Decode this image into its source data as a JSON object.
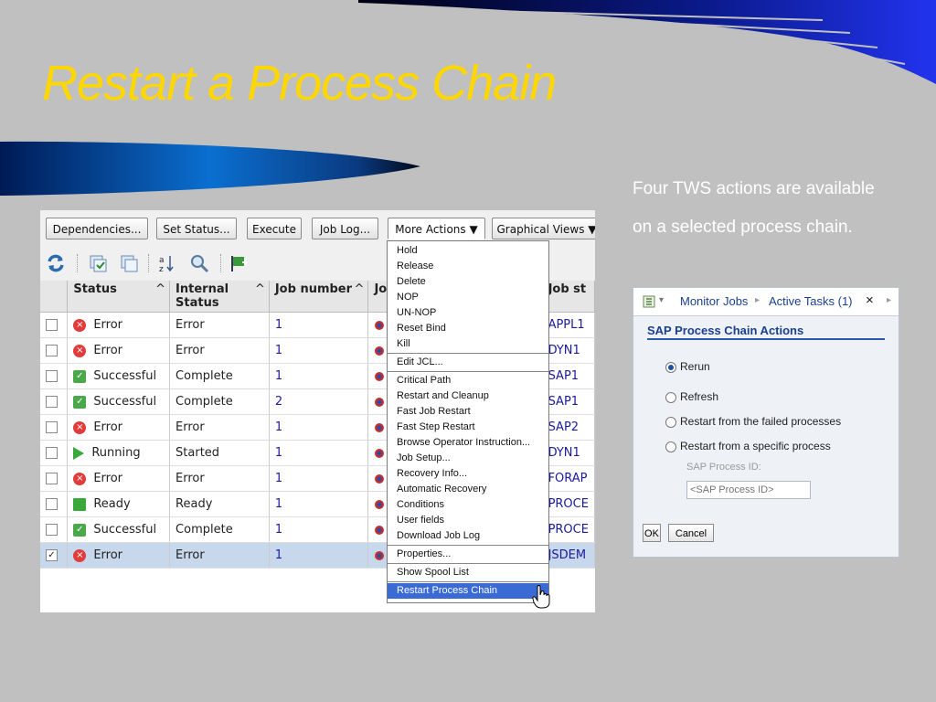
{
  "slide": {
    "title": "Restart a Process Chain",
    "description_line1": "Four TWS actions are available",
    "description_line2": "on a selected process chain."
  },
  "toolbar": {
    "dependencies": "Dependencies...",
    "set_status": "Set Status...",
    "execute": "Execute",
    "job_log": "Job Log...",
    "more_actions": "More Actions ▼",
    "graphical_views": "Graphical Views ▼"
  },
  "table": {
    "headers": {
      "status": "Status",
      "internal_status": "Internal Status",
      "job_number": "Job number",
      "job_name_prefix": "Jo",
      "job_stream": "Job st"
    },
    "rows": [
      {
        "status": "Error",
        "internal": "Error",
        "number": "1",
        "stream": "APPL1",
        "selected": false,
        "kind": "err"
      },
      {
        "status": "Error",
        "internal": "Error",
        "number": "1",
        "stream": "DYN1",
        "selected": false,
        "kind": "err"
      },
      {
        "status": "Successful",
        "internal": "Complete",
        "number": "1",
        "stream": "SAP1",
        "selected": false,
        "kind": "ok"
      },
      {
        "status": "Successful",
        "internal": "Complete",
        "number": "2",
        "stream": "SAP1",
        "selected": false,
        "kind": "ok"
      },
      {
        "status": "Error",
        "internal": "Error",
        "number": "1",
        "stream": "SAP2",
        "selected": false,
        "kind": "err"
      },
      {
        "status": "Running",
        "internal": "Started",
        "number": "1",
        "stream": "DYN1",
        "selected": false,
        "kind": "run"
      },
      {
        "status": "Error",
        "internal": "Error",
        "number": "1",
        "stream": "FORAP",
        "selected": false,
        "kind": "err"
      },
      {
        "status": "Ready",
        "internal": "Ready",
        "number": "1",
        "stream": "PROCE",
        "selected": false,
        "kind": "ready"
      },
      {
        "status": "Successful",
        "internal": "Complete",
        "number": "1",
        "stream": "PROCE",
        "selected": false,
        "kind": "ok"
      },
      {
        "status": "Error",
        "internal": "Error",
        "number": "1",
        "stream": "JSDEM",
        "selected": true,
        "kind": "err"
      }
    ]
  },
  "menu": {
    "items": [
      "Hold",
      "Release",
      "Delete",
      "NOP",
      "UN-NOP",
      "Reset Bind",
      "Kill",
      "Edit JCL...",
      "Critical Path",
      "Restart and Cleanup",
      "Fast Job Restart",
      "Fast Step Restart",
      "Browse Operator Instruction...",
      "Job Setup...",
      "Recovery Info...",
      "Automatic Recovery",
      "Conditions",
      "User fields",
      "Download Job Log",
      "Properties...",
      "Show Spool List",
      "Restart Process Chain"
    ]
  },
  "sap_panel": {
    "breadcrumb_monitor": "Monitor Jobs",
    "breadcrumb_active": "Active Tasks (1)",
    "close_glyph": "×",
    "heading": "SAP Process Chain Actions",
    "options": [
      "Rerun",
      "Refresh",
      "Restart from the failed processes",
      "Restart from a specific process"
    ],
    "selected_option": "Rerun",
    "process_id_label": "SAP Process ID:",
    "process_id_placeholder": "<SAP Process ID>",
    "ok": "OK",
    "cancel": "Cancel"
  },
  "colors": {
    "title": "#ffd700",
    "background": "#c0c0c0",
    "menu_highlight": "#3a6ad4",
    "selected_row": "#c8d8ec"
  }
}
